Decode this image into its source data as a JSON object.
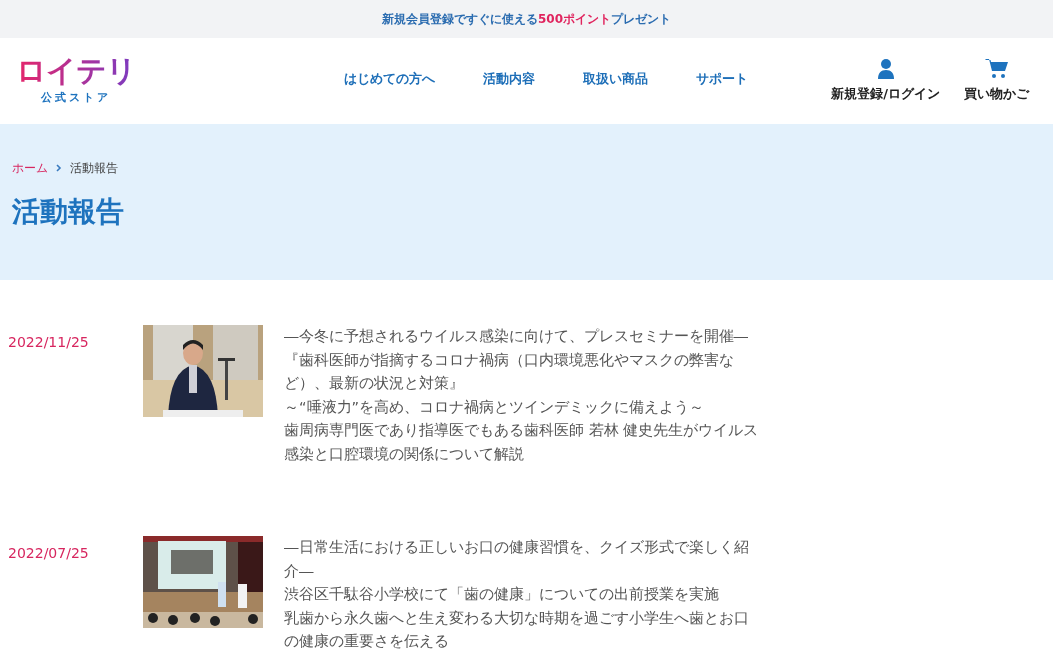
{
  "banner": {
    "parts": [
      {
        "text": "新規会員登録ですぐに使える",
        "highlight": false
      },
      {
        "text": "500ポイント",
        "highlight": true
      },
      {
        "text": "プレゼント",
        "highlight": false
      }
    ]
  },
  "logo": {
    "name": "ロイテリ",
    "subtitle": "公式ストア"
  },
  "nav": [
    "はじめての方へ",
    "活動内容",
    "取扱い商品",
    "サポート"
  ],
  "header_actions": [
    {
      "kind": "account",
      "label": "新規登録/ログイン"
    },
    {
      "kind": "cart",
      "label": "買い物かご"
    }
  ],
  "breadcrumb": [
    {
      "label": "ホーム",
      "link": true
    },
    {
      "label": "活動報告",
      "link": false
    }
  ],
  "page_title": "活動報告",
  "articles": [
    {
      "date": "2022/11/25",
      "image": {
        "kind": "picture"
      },
      "lines": [
        "―今冬に予想されるウイルス感染に向けて、プレスセミナーを開催―",
        "『歯科医師が指摘するコロナ禍病（口内環境悪化やマスクの弊害など）、最新の状況と対策』",
        "～“唾液力”を高め、コロナ禍病とツインデミックに備えよう～",
        "歯周病専門医であり指導医でもある歯科医師 若林 健史先生がウイルス感染と口腔環境の関係について解説"
      ]
    },
    {
      "date": "2022/07/25",
      "image": {
        "kind": "picture"
      },
      "lines": [
        "―日常生活における正しいお口の健康習慣を、クイズ形式で楽しく紹介―",
        "渋谷区千駄谷小学校にて「歯の健康」についての出前授業を実施",
        "乳歯から永久歯へと生え変わる大切な時期を過ごす小学生へ歯とお口の健康の重要さを伝える"
      ]
    }
  ]
}
